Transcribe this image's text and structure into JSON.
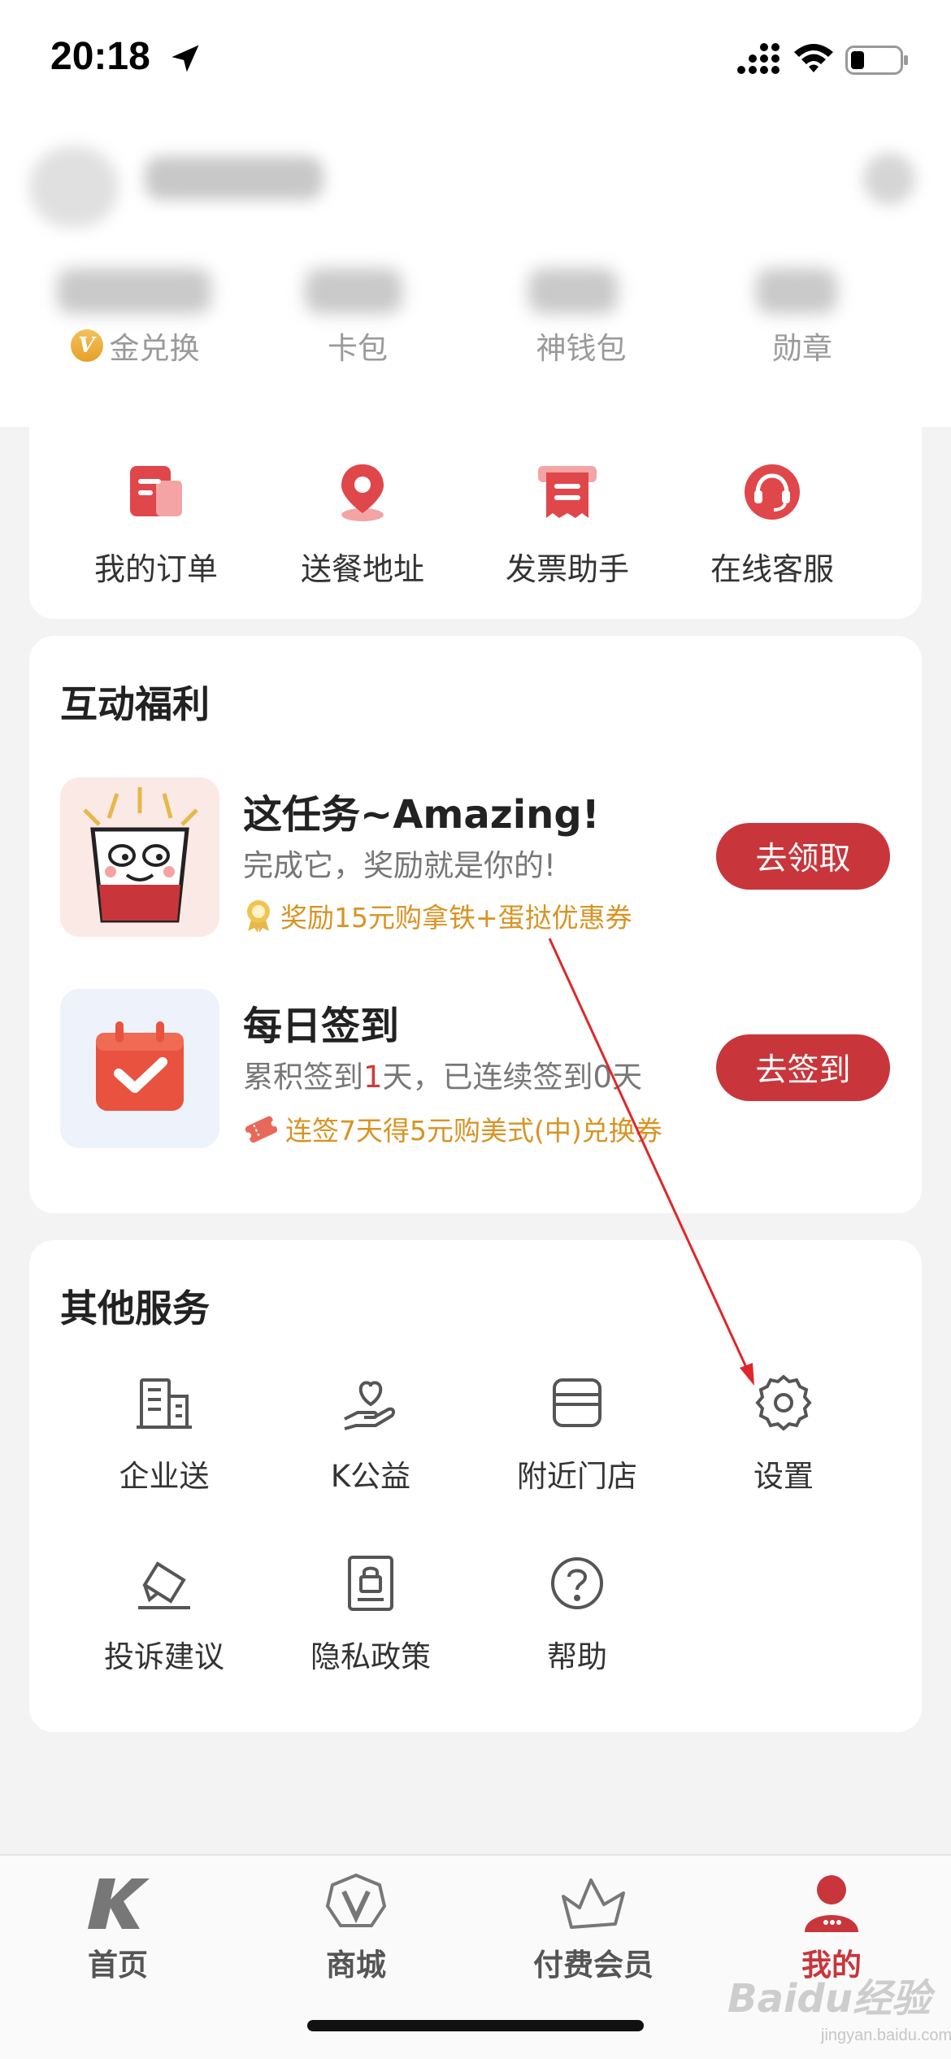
{
  "status_bar": {
    "time": "20:18"
  },
  "stats": [
    {
      "label": "金兑换",
      "badge": "V"
    },
    {
      "label": "卡包"
    },
    {
      "label": "神钱包"
    },
    {
      "label": "勋章"
    }
  ],
  "quick_actions": [
    {
      "label": "我的订单",
      "icon": "order-icon"
    },
    {
      "label": "送餐地址",
      "icon": "location-pin-icon"
    },
    {
      "label": "发票助手",
      "icon": "invoice-icon"
    },
    {
      "label": "在线客服",
      "icon": "headset-icon"
    }
  ],
  "welfare": {
    "title": "互动福利",
    "tasks": [
      {
        "title": "这任务~Amazing!",
        "desc": "完成它，奖励就是你的!",
        "reward": "奖励15元购拿铁+蛋挞优惠券",
        "button": "去领取"
      },
      {
        "title": "每日签到",
        "desc_prefix": "累积签到",
        "desc_count1": "1",
        "desc_mid": "天，已连续签到",
        "desc_count2": "0",
        "desc_suffix": "天",
        "reward": "连签7天得5元购美式(中)兑换券",
        "button": "去签到"
      }
    ]
  },
  "services": {
    "title": "其他服务",
    "items": [
      {
        "label": "企业送",
        "icon": "building-icon"
      },
      {
        "label": "K公益",
        "icon": "charity-icon"
      },
      {
        "label": "附近门店",
        "icon": "store-icon"
      },
      {
        "label": "设置",
        "icon": "gear-icon"
      },
      {
        "label": "投诉建议",
        "icon": "feedback-icon"
      },
      {
        "label": "隐私政策",
        "icon": "privacy-icon"
      },
      {
        "label": "帮助",
        "icon": "help-icon"
      }
    ]
  },
  "tabs": [
    {
      "label": "首页",
      "icon": "home-k-icon",
      "active": false
    },
    {
      "label": "商城",
      "icon": "mall-v-icon",
      "active": false
    },
    {
      "label": "付费会员",
      "icon": "crown-icon",
      "active": false
    },
    {
      "label": "我的",
      "icon": "profile-icon",
      "active": true
    }
  ],
  "watermark": {
    "text": "Baidu经验",
    "sub": "jingyan.baidu.com"
  },
  "colors": {
    "brand_red": "#c8363b",
    "reward_gold": "#d99322",
    "annotation_arrow": "#e0262a"
  }
}
